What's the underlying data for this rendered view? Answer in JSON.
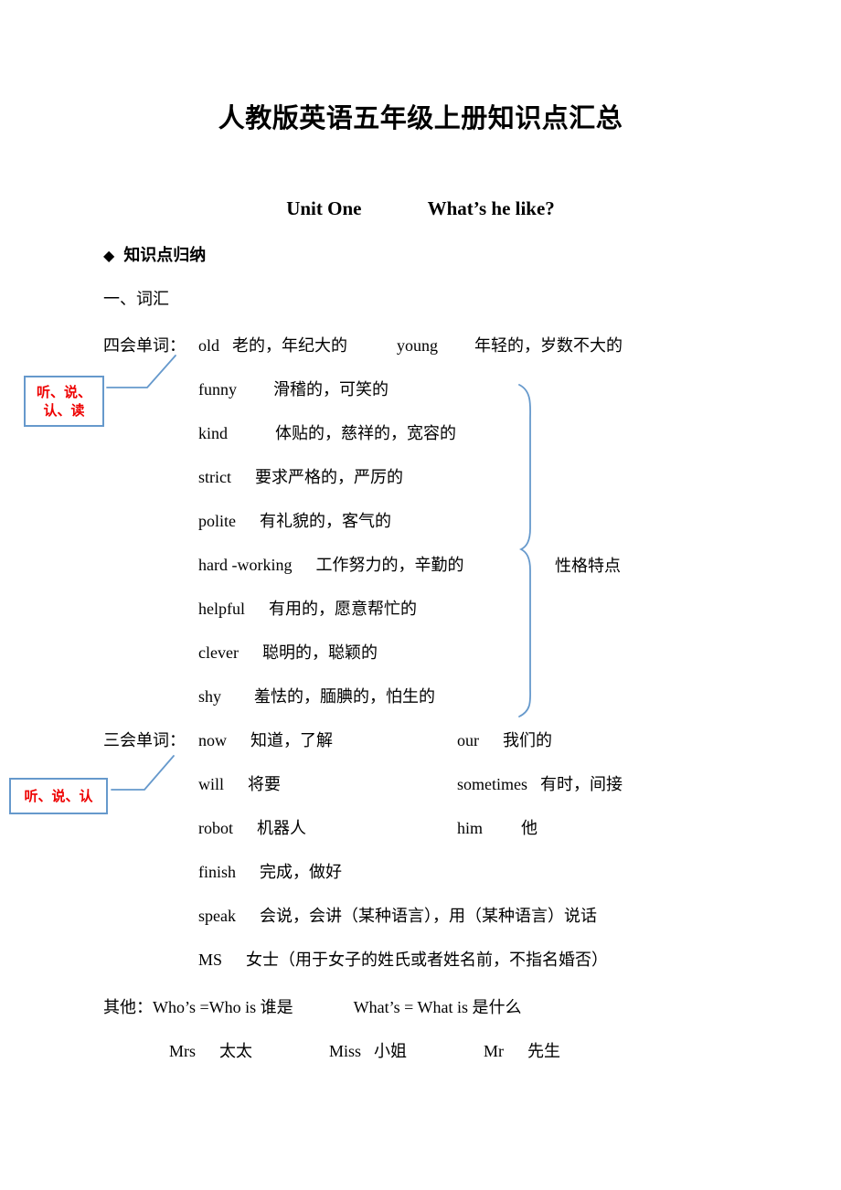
{
  "document": {
    "title": "人教版英语五年级上册知识点汇总",
    "unit_label": "Unit One",
    "unit_topic": "What’s he like?",
    "bullet_symbol": "◆",
    "bullet_heading": "知识点归纳",
    "section_heading": "一、词汇"
  },
  "four_skills": {
    "label": "四会单词：",
    "callout": "听、说、\n认、读",
    "callout_line1": "听、说、",
    "callout_line2": "认、读",
    "brace_label": "性格特点",
    "entries": [
      {
        "word": "old",
        "meaning": "老的，年纪大的",
        "word2": "young",
        "meaning2": "年轻的，岁数不大的"
      },
      {
        "word": "funny",
        "meaning": "滑稽的，可笑的"
      },
      {
        "word": "kind",
        "meaning": "体贴的，慈祥的，宽容的"
      },
      {
        "word": "strict",
        "meaning": "要求严格的，严厉的"
      },
      {
        "word": "polite",
        "meaning": "有礼貌的，客气的"
      },
      {
        "word": "hard -working",
        "meaning": "工作努力的，辛勤的"
      },
      {
        "word": "helpful",
        "meaning": "有用的，愿意帮忙的"
      },
      {
        "word": "clever",
        "meaning": "聪明的，聪颖的"
      },
      {
        "word": "shy",
        "meaning": "羞怯的，腼腆的，怕生的"
      }
    ]
  },
  "three_skills": {
    "label": "三会单词：",
    "callout": "听、说、认",
    "entries": [
      {
        "word": "now",
        "meaning": "知道，了解",
        "word2": "our",
        "meaning2": "我们的"
      },
      {
        "word": "will",
        "meaning": "将要",
        "word2": "sometimes",
        "meaning2": "有时，间接"
      },
      {
        "word": "robot",
        "meaning": "机器人",
        "word2": "him",
        "meaning2": "他"
      },
      {
        "word": "finish",
        "meaning": "完成，做好"
      },
      {
        "word": "speak",
        "meaning": "会说，会讲（某种语言），用（某种语言）说话"
      },
      {
        "word": "MS",
        "meaning": "女士（用于女子的姓氏或者姓名前，不指名婚否）"
      }
    ]
  },
  "others": {
    "label": "其他：",
    "item1": "Who’s =Who is  谁是",
    "item2": "What’s = What is  是什么",
    "titles": [
      {
        "en": "Mrs",
        "zh": "太太"
      },
      {
        "en": "Miss",
        "zh": "小姐"
      },
      {
        "en": "Mr",
        "zh": "先生"
      }
    ]
  },
  "colors": {
    "callout_text": "#ee0000",
    "callout_border": "#6699cc",
    "brace": "#6699cc",
    "text": "#000000",
    "background": "#ffffff"
  }
}
